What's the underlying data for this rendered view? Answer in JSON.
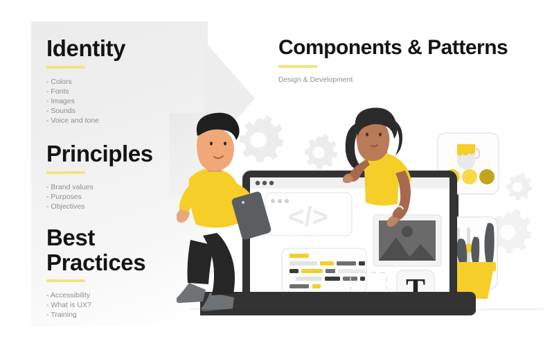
{
  "left_panel": {
    "sections": [
      {
        "title": "Identity",
        "items": [
          "- Colors",
          "- Fonts",
          "- Images",
          "- Sounds",
          "- Voice and tone"
        ]
      },
      {
        "title": "Principles",
        "items": [
          "- Brand values",
          "- Purposes",
          "- Objectives"
        ]
      },
      {
        "title": "Best\nPractices",
        "title_line1": "Best",
        "title_line2": "Practices",
        "items": [
          "- Accessibility",
          "- What is UX?",
          "- Training"
        ]
      }
    ]
  },
  "header": {
    "title": "Components & Patterns",
    "subtitle": "Design & Development"
  },
  "illustration": {
    "code_glyph": "</>",
    "typography_glyph": "T",
    "browser_dots": 3,
    "palette_swatches": [
      "#F5CE28",
      "#F8D94A",
      "#C3A519"
    ],
    "slider_count": 3
  },
  "colors": {
    "accent_yellow": "#F7E27C",
    "brand_yellow": "#F5CE28",
    "heading_dark": "#141414",
    "body_gray": "#8e8e8e",
    "panel_gray": "#ededed",
    "device_dark": "#333333"
  }
}
